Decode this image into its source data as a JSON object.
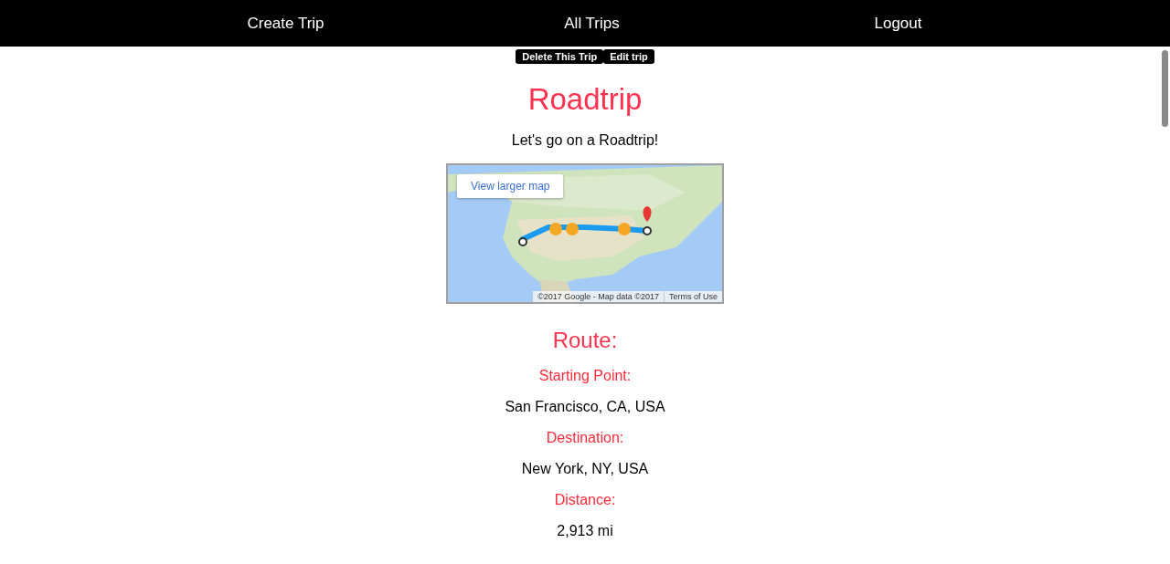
{
  "nav": [
    "Create Trip",
    "All Trips",
    "Logout"
  ],
  "actions": [
    "Delete This Trip",
    "Edit trip"
  ],
  "trip": {
    "title": "Roadtrip",
    "description": "Let's go on a Roadtrip!"
  },
  "map": {
    "kind": "picture",
    "button": "View larger map",
    "attribution": "©2017 Google - Map data ©2017",
    "terms": "Terms of Use"
  },
  "route": {
    "heading": "Route:",
    "fields": [
      {
        "label": "Starting Point:",
        "value": "San Francisco, CA, USA"
      },
      {
        "label": "Destination:",
        "value": "New York, NY, USA"
      },
      {
        "label": "Distance:",
        "value": "2,913 mi"
      }
    ]
  }
}
